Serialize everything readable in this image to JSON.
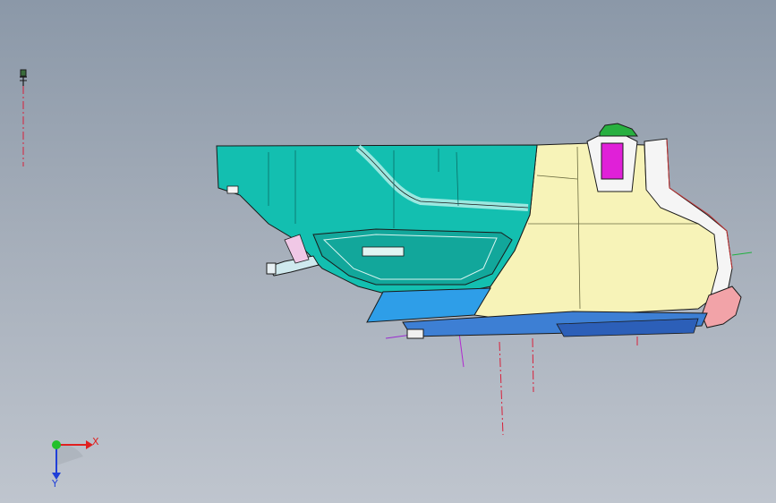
{
  "viewport": {
    "background_top": "#8b98a8",
    "background_bottom": "#bfc5ce"
  },
  "triad": {
    "x_label": "X",
    "y_label": "Y",
    "x_color": "#e02020",
    "y_color": "#1f3fd8",
    "z_color": "#22c02a"
  },
  "model": {
    "colors": {
      "upper_panel": "#13bfb0",
      "lower_housing": "#f7f3b8",
      "bottom_strip": "#2e8fe6",
      "accent_magenta": "#e020d8",
      "accent_green": "#28b040",
      "accent_pink": "#f2a3a8",
      "outline": "#1a1a1a"
    },
    "icons": [
      "axis-triad-icon",
      "origin-marker-icon"
    ]
  }
}
